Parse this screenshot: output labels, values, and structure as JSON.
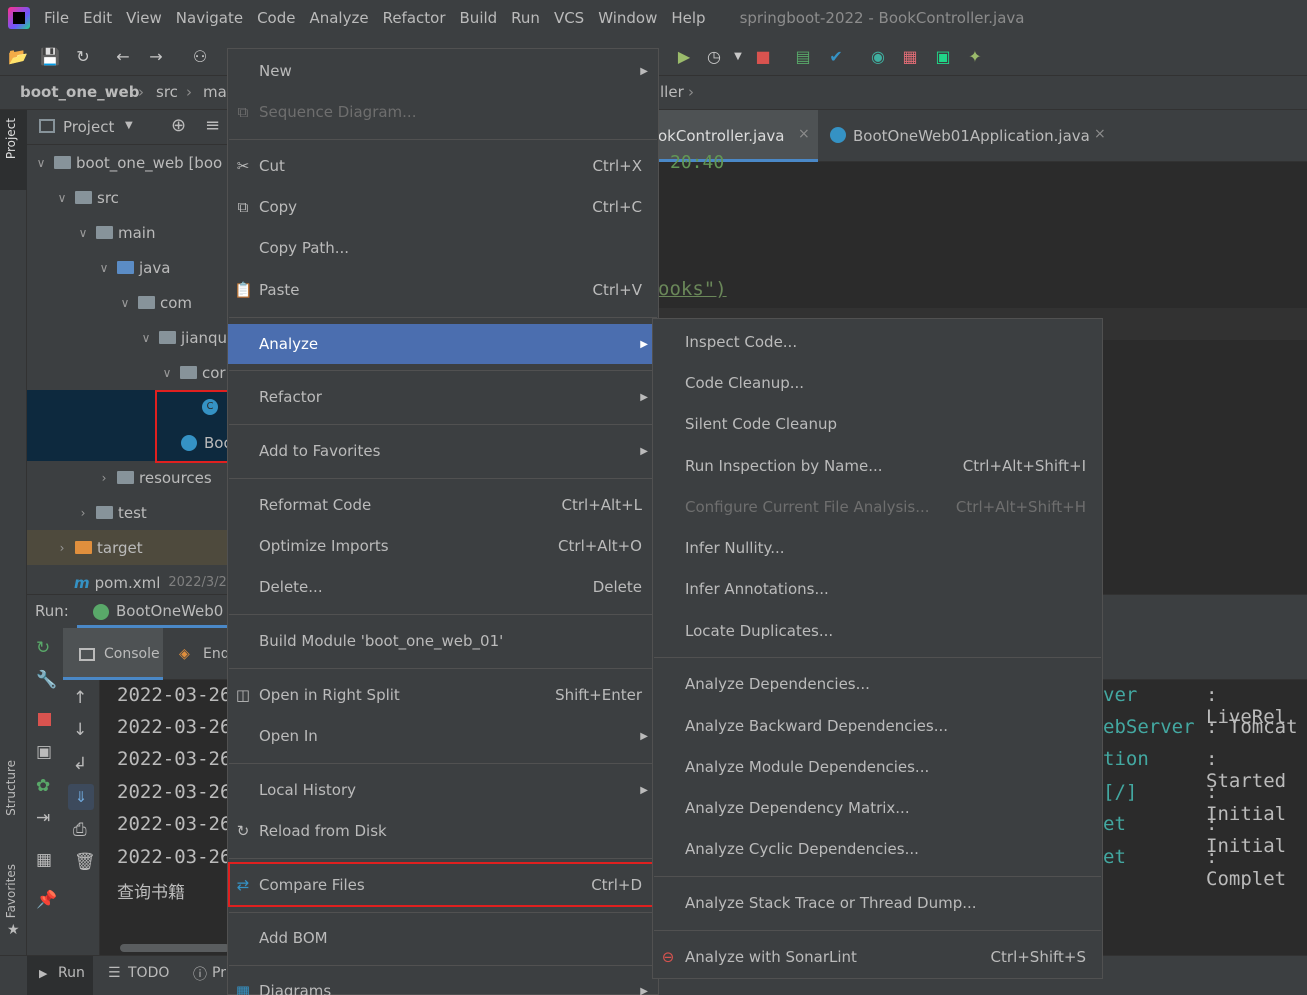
{
  "menubar": {
    "items": [
      "File",
      "Edit",
      "View",
      "Navigate",
      "Code",
      "Analyze",
      "Refactor",
      "Build",
      "Run",
      "VCS",
      "Window",
      "Help"
    ],
    "window_title": "springboot-2022 - BookController.java"
  },
  "breadcrumb": [
    "boot_one_web",
    "src",
    "ma",
    "ller"
  ],
  "project": {
    "header": "Project",
    "tree": [
      {
        "label": "boot_one_web [boo",
        "level": 0
      },
      {
        "label": "src",
        "level": 1
      },
      {
        "label": "main",
        "level": 2
      },
      {
        "label": "java",
        "level": 3
      },
      {
        "label": "com",
        "level": 4
      },
      {
        "label": "jianqu",
        "level": 5
      },
      {
        "label": "cor",
        "level": 6
      },
      {
        "label": "",
        "level": 7
      },
      {
        "label": "Boo",
        "level": 7
      },
      {
        "label": "resources",
        "level": 3
      },
      {
        "label": "test",
        "level": 2
      },
      {
        "label": "target",
        "level": 1
      },
      {
        "label": "pom.xml",
        "level": 1,
        "meta": "2022/3/2"
      }
    ],
    "side_tab": "Project"
  },
  "editor": {
    "tabs": [
      "okController.java",
      "BootOneWeb01Application.java"
    ],
    "code_fragments": [
      "20:40",
      "ooks\")"
    ]
  },
  "run": {
    "label": "Run:",
    "config": "BootOneWeb0",
    "tabs": [
      "Console",
      "End"
    ],
    "lines": [
      {
        "date": "2022-03-26",
        "mid": "ver",
        "text": ": LiveRel"
      },
      {
        "date": "2022-03-26",
        "mid": "ebServer",
        "text": ": Tomcat"
      },
      {
        "date": "2022-03-26",
        "mid": "tion",
        "text": ": Started"
      },
      {
        "date": "2022-03-26",
        "mid": "[/]",
        "text": ": Initial"
      },
      {
        "date": "2022-03-26",
        "mid": "et",
        "text": ": Initial"
      },
      {
        "date": "2022-03-26",
        "mid": "et",
        "text": ": Complet"
      },
      {
        "date": "查询书籍",
        "mid": "",
        "text": ""
      }
    ]
  },
  "side_tabs": {
    "structure": "Structure",
    "favorites": "Favorites"
  },
  "statusbar": {
    "run": "Run",
    "todo": "TODO",
    "problems": "Pr"
  },
  "context_menu": {
    "items": [
      {
        "label": "New",
        "shortcut": "",
        "submenu": true
      },
      {
        "label": "Sequence Diagram...",
        "shortcut": "",
        "disabled": true,
        "icon": "sequence-diagram-icon"
      },
      {
        "label": "Cut",
        "shortcut": "Ctrl+X",
        "icon": "scissors-icon"
      },
      {
        "label": "Copy",
        "shortcut": "Ctrl+C",
        "icon": "copy-icon"
      },
      {
        "label": "Copy Path...",
        "shortcut": ""
      },
      {
        "label": "Paste",
        "shortcut": "Ctrl+V",
        "icon": "paste-icon"
      },
      {
        "label": "Analyze",
        "shortcut": "",
        "submenu": true,
        "selected": true
      },
      {
        "label": "Refactor",
        "shortcut": "",
        "submenu": true
      },
      {
        "label": "Add to Favorites",
        "shortcut": "",
        "submenu": true
      },
      {
        "label": "Reformat Code",
        "shortcut": "Ctrl+Alt+L"
      },
      {
        "label": "Optimize Imports",
        "shortcut": "Ctrl+Alt+O"
      },
      {
        "label": "Delete...",
        "shortcut": "Delete"
      },
      {
        "label": "Build Module 'boot_one_web_01'",
        "shortcut": ""
      },
      {
        "label": "Open in Right Split",
        "shortcut": "Shift+Enter",
        "icon": "split-icon"
      },
      {
        "label": "Open In",
        "shortcut": "",
        "submenu": true
      },
      {
        "label": "Local History",
        "shortcut": "",
        "submenu": true
      },
      {
        "label": "Reload from Disk",
        "shortcut": "",
        "icon": "reload-icon"
      },
      {
        "label": "Compare Files",
        "shortcut": "Ctrl+D",
        "icon": "compare-icon"
      },
      {
        "label": "Add BOM",
        "shortcut": ""
      },
      {
        "label": "Diagrams",
        "shortcut": "",
        "submenu": true,
        "icon": "diagram-icon"
      }
    ]
  },
  "analyze_menu": {
    "items": [
      {
        "label": "Inspect Code...",
        "shortcut": ""
      },
      {
        "label": "Code Cleanup...",
        "shortcut": ""
      },
      {
        "label": "Silent Code Cleanup",
        "shortcut": ""
      },
      {
        "label": "Run Inspection by Name...",
        "shortcut": "Ctrl+Alt+Shift+I"
      },
      {
        "label": "Configure Current File Analysis...",
        "shortcut": "Ctrl+Alt+Shift+H",
        "disabled": true
      },
      {
        "label": "Infer Nullity...",
        "shortcut": ""
      },
      {
        "label": "Infer Annotations...",
        "shortcut": ""
      },
      {
        "label": "Locate Duplicates...",
        "shortcut": ""
      },
      {
        "label": "Analyze Dependencies...",
        "shortcut": ""
      },
      {
        "label": "Analyze Backward Dependencies...",
        "shortcut": ""
      },
      {
        "label": "Analyze Module Dependencies...",
        "shortcut": ""
      },
      {
        "label": "Analyze Dependency Matrix...",
        "shortcut": ""
      },
      {
        "label": "Analyze Cyclic Dependencies...",
        "shortcut": ""
      },
      {
        "label": "Analyze Stack Trace or Thread Dump...",
        "shortcut": ""
      },
      {
        "label": "Analyze with SonarLint",
        "shortcut": "Ctrl+Shift+S",
        "icon": "sonarlint-icon"
      }
    ]
  },
  "colors": {
    "selection": "#4b6eaf",
    "highlight_box": "#e0201f",
    "tree_selection": "#0d293e"
  }
}
